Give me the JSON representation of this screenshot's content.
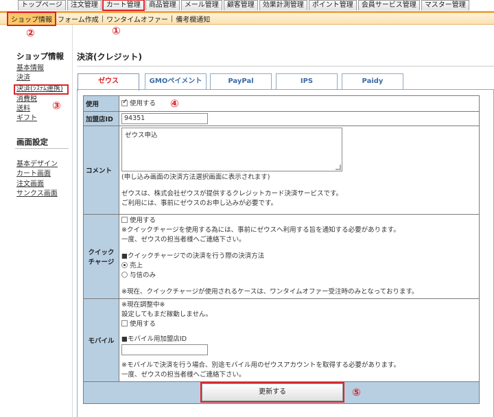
{
  "topnav": {
    "tabs": [
      "トップページ",
      "注文管理",
      "カート管理",
      "商品管理",
      "メール管理",
      "顧客管理",
      "効果計測管理",
      "ポイント管理",
      "会員サービス管理",
      "マスター管理"
    ],
    "active_index": 2
  },
  "subnav": {
    "items": [
      "ショップ情報",
      "フォーム作成",
      "ワンタイムオファー",
      "備考欄通知"
    ],
    "active_index": 0
  },
  "markers": [
    "①",
    "②",
    "③",
    "④",
    "⑤"
  ],
  "sidebar": {
    "shop_title": "ショップ情報",
    "shop_links": [
      "基本情報",
      "決済",
      "決済(ｼｽﾃﾑ連携)",
      "消費税",
      "送料",
      "ギフト"
    ],
    "screen_title": "画面設定",
    "screen_links": [
      "基本デザイン",
      "カート画面",
      "注文画面",
      "サンクス画面"
    ]
  },
  "main": {
    "title": "決済(クレジット)",
    "tabs": [
      "ゼウス",
      "GMOペイメント",
      "PayPal",
      "IPS",
      "Paidy"
    ],
    "active_tab": 0
  },
  "form": {
    "use": {
      "label": "使用",
      "checkbox_label": "使用する",
      "checked": true
    },
    "merchant": {
      "label": "加盟店ID",
      "value": "94351"
    },
    "comment": {
      "label": "コメント",
      "value": "ゼウス申込",
      "hint": "(申し込み画面の決済方法選択画面に表示されます)",
      "desc1": "ゼウスは、株式会社ゼウスが提供するクレジットカード決済サービスです。",
      "desc2": "ご利用には、事前にゼウスのお申し込みが必要です。"
    },
    "quick": {
      "label1": "クイック",
      "label2": "チャージ",
      "checkbox_label": "使用する",
      "note1": "※クイックチャージを使用する為には、事前にゼウスへ利用する旨を通知する必要があります。",
      "note2": "一度、ゼウスの担当者様へご連絡下さい。",
      "method_title": "■クイックチャージでの決済を行う際の決済方法",
      "opt1": "売上",
      "opt2": "与信のみ",
      "note3": "※現在、クイックチャージが使用されるケースは、ワンタイムオファー受注時のみとなっております。"
    },
    "mobile": {
      "label": "モバイル",
      "status1": "※現在調整中※",
      "status2": "設定してもまだ稼動しません。",
      "checkbox_label": "使用する",
      "id_title": "■モバイル用加盟店ID",
      "id_value": "",
      "note1": "※モバイルで決済を行う場合、別途モバイル用のゼウスアカウントを取得する必要があります。",
      "note2": "一度、ゼウスの担当者様へご連絡下さい。"
    },
    "submit_label": "更新する"
  }
}
